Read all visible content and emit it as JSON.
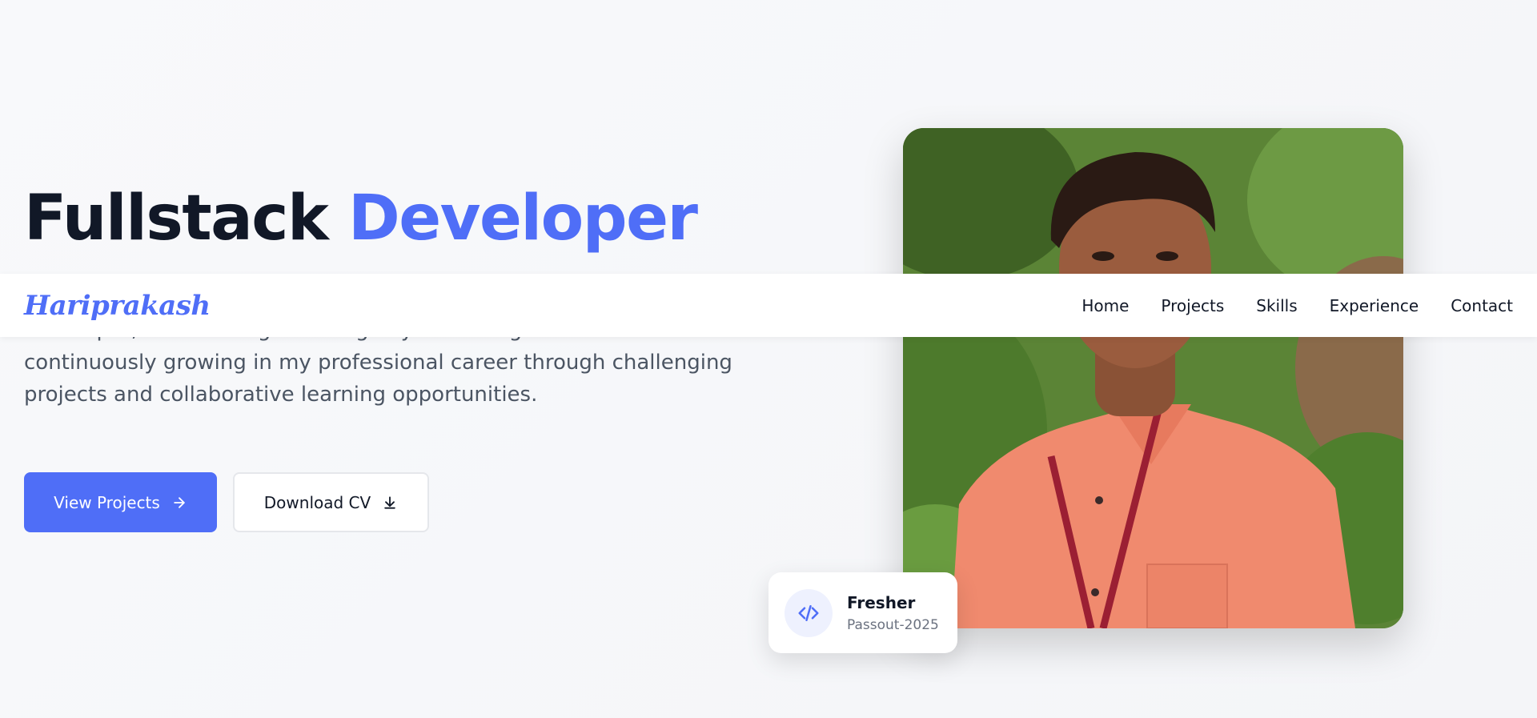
{
  "hero": {
    "title_main": "Fullstack ",
    "title_accent": "Developer",
    "description_lines": [
      "Developer, contributing meaningfully to the organization's success while",
      "continuously growing in my professional career through challenging",
      "projects and collaborative learning opportunities."
    ],
    "primary_button": "View Projects",
    "secondary_button": "Download CV"
  },
  "badge": {
    "title": "Fresher",
    "subtitle": "Passout-2025",
    "icon": "code-icon"
  },
  "navbar": {
    "logo": "Hariprakash",
    "links": [
      "Home",
      "Projects",
      "Skills",
      "Experience",
      "Contact"
    ]
  },
  "colors": {
    "accent": "#4f6ef7",
    "text_dark": "#111827",
    "text_muted": "#4b5563",
    "background": "#f6f7f9"
  },
  "icons": {
    "primary_button_icon": "arrow-right-icon",
    "secondary_button_icon": "download-icon"
  }
}
